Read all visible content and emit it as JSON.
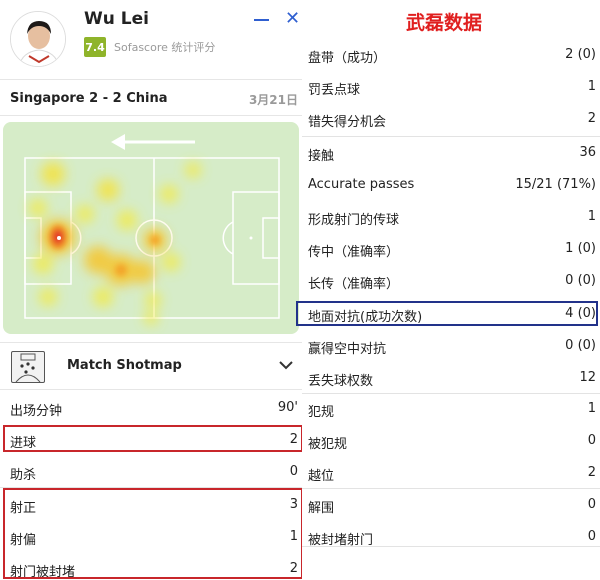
{
  "player": {
    "name": "Wu Lei",
    "rating": "7.4",
    "rating_source": "Sofascore 统计评分"
  },
  "match": {
    "title": "Singapore 2 - 2 China",
    "date": "3月21日"
  },
  "shotmap": {
    "label": "Match Shotmap"
  },
  "left_stats": [
    {
      "label": "出场分钟",
      "value": "90'"
    },
    {
      "label": "进球",
      "value": "2"
    },
    {
      "label": "助杀",
      "value": "0"
    },
    {
      "label": "射正",
      "value": "3"
    },
    {
      "label": "射偏",
      "value": "1"
    },
    {
      "label": "射门被封堵",
      "value": "2"
    }
  ],
  "right_panel": {
    "title": "武磊数据",
    "stats": [
      {
        "label": "盘带（成功）",
        "value": "2 (0)"
      },
      {
        "label": "罚丢点球",
        "value": "1"
      },
      {
        "label": "错失得分机会",
        "value": "2"
      },
      {
        "label": "接触",
        "value": "36"
      },
      {
        "label": "Accurate passes",
        "value": "15/21 (71%)"
      },
      {
        "label": "形成射门的传球",
        "value": "1"
      },
      {
        "label": "传中（准确率）",
        "value": "1 (0)"
      },
      {
        "label": "长传（准确率）",
        "value": "0 (0)"
      },
      {
        "label": "地面对抗(成功次数)",
        "value": "4 (0)"
      },
      {
        "label": "赢得空中对抗",
        "value": "0 (0)"
      },
      {
        "label": "丢失球权数",
        "value": "12"
      },
      {
        "label": "犯规",
        "value": "1"
      },
      {
        "label": "被犯规",
        "value": "0"
      },
      {
        "label": "越位",
        "value": "2"
      },
      {
        "label": "解围",
        "value": "0"
      },
      {
        "label": "被封堵射门",
        "value": "0"
      }
    ]
  },
  "colors": {
    "pitch": "#d6ecc8",
    "pitch_lines": "#ffffff",
    "rating_badge": "#8fb42a",
    "accent_blue": "#2f5fd0",
    "highlight_red": "#c8262b",
    "highlight_navy": "#22328a",
    "title_red": "#e01f1f"
  }
}
